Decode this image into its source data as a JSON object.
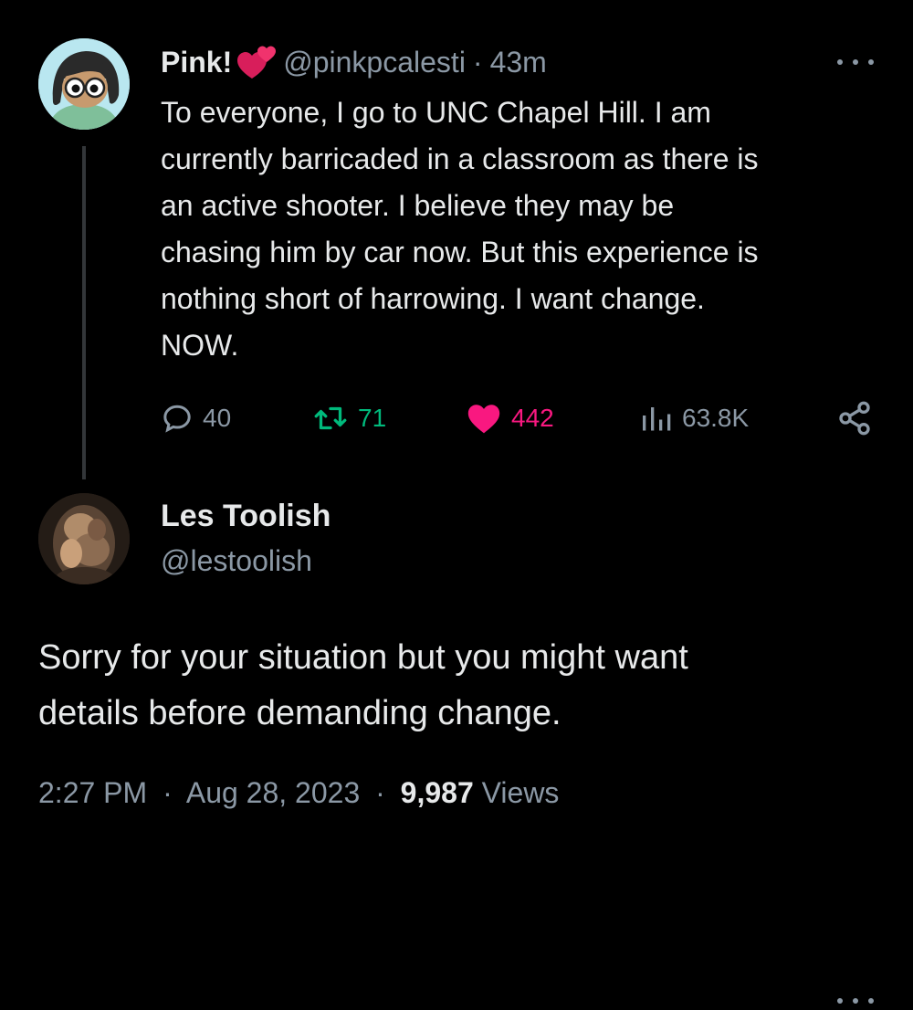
{
  "tweet": {
    "author": {
      "name": "Pink!",
      "handle": "@pinkpcalesti",
      "avatar_icon": "cartoon-avatar"
    },
    "time": "43m",
    "separator": "·",
    "text": "To everyone, I go to UNC Chapel Hill. I am\ncurrently barricaded in a classroom as there is\nan active shooter. I believe they may be\nchasing him by car now. But this experience is\nnothing short of harrowing. I want change.\nNOW.",
    "stats": {
      "replies": "40",
      "retweets": "71",
      "likes": "442",
      "views": "63.8K"
    }
  },
  "reply": {
    "author": {
      "name": "Les Toolish",
      "handle": "@lestoolish",
      "avatar_icon": "photo-avatar"
    },
    "text": "Sorry for your situation but you might want\ndetails before demanding change.",
    "timestamp_time": "2:27 PM",
    "separator": "·",
    "timestamp_date": "Aug 28, 2023",
    "views_count": "9,987",
    "views_label": "Views"
  },
  "colors": {
    "background": "#000000",
    "text_primary": "#e7e9ea",
    "text_secondary": "#8b98a5",
    "retweet_green": "#00ba7c",
    "like_pink": "#f91880"
  }
}
